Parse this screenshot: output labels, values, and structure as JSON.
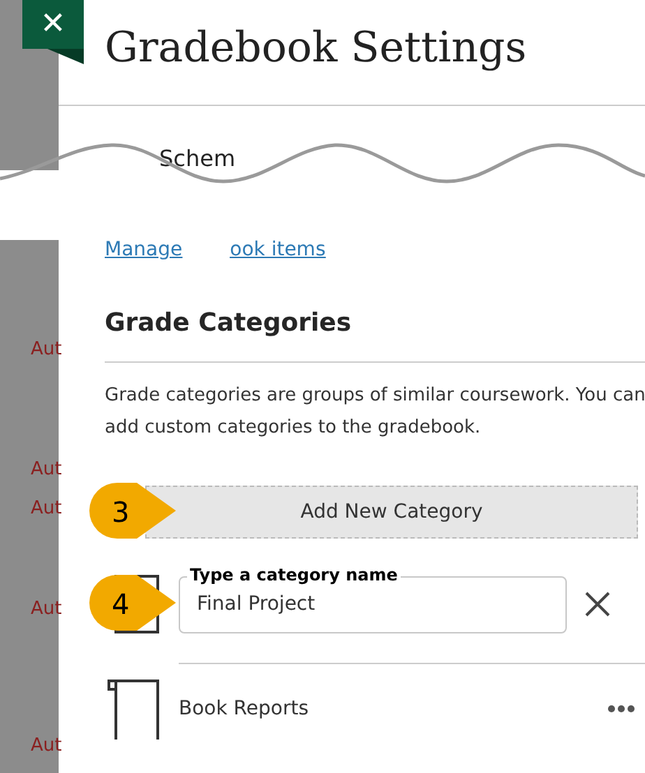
{
  "background_rows": [
    {
      "label": "Aut"
    },
    {
      "label": "Aut"
    },
    {
      "label": "Aut"
    },
    {
      "label": "Aut"
    },
    {
      "label": "Aut"
    }
  ],
  "close_button": {
    "label": "✕"
  },
  "panel": {
    "title": "Gradebook Settings",
    "partial_heading": "Schem",
    "link_parts": [
      "Manage",
      "ook items"
    ],
    "section": {
      "title": "Grade Categories",
      "description": "Grade categories are groups of similar coursework. You can add custom categories to the gradebook."
    },
    "add_button": {
      "label": "Add New Category",
      "callout": "3"
    },
    "new_category": {
      "label": "Type a category name",
      "value": "Final Project",
      "callout": "4"
    },
    "categories": [
      {
        "name": "Book Reports"
      }
    ]
  }
}
